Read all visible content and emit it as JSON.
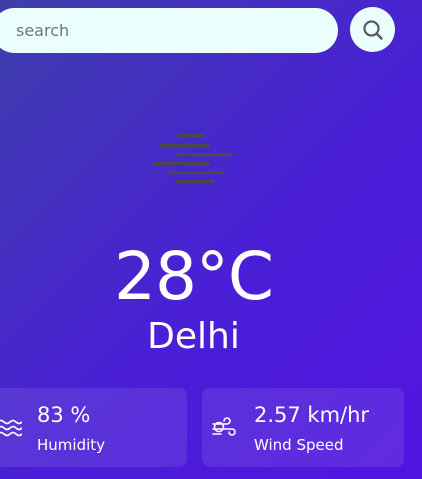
{
  "search": {
    "placeholder": "search",
    "button_icon": "search-icon"
  },
  "weather": {
    "condition_icon": "mist-icon",
    "temperature": "28°C",
    "city": "Delhi"
  },
  "details": {
    "humidity": {
      "icon": "humidity-waves-icon",
      "value": "83 %",
      "label": "Humidity"
    },
    "wind": {
      "icon": "wind-icon",
      "value": "2.57 km/hr",
      "label": "Wind Speed"
    }
  },
  "colors": {
    "background_start": "#3d3faa",
    "background_end": "#5214e0",
    "search_background": "#ebfffc",
    "text": "#ffffff",
    "mist_icon": "#4a4a4a"
  }
}
